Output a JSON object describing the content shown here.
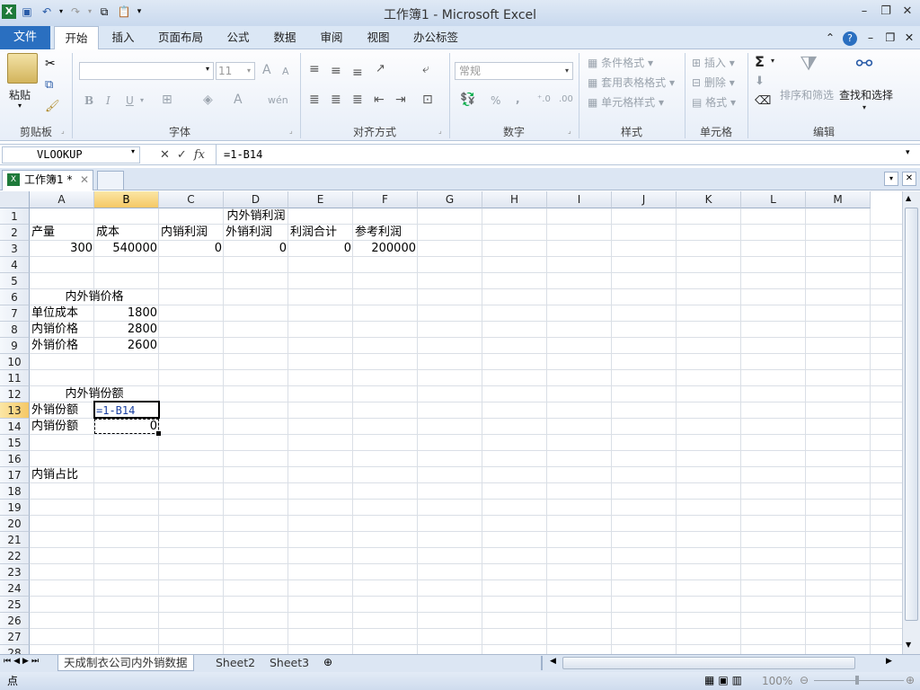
{
  "window": {
    "title": "工作簿1 - Microsoft Excel"
  },
  "qat": {
    "icons": [
      "excel-logo-icon",
      "save-icon",
      "undo-icon",
      "redo-icon",
      "copy-icon",
      "paste-icon",
      "customize-qat-icon"
    ]
  },
  "tabs": [
    "文件",
    "开始",
    "插入",
    "页面布局",
    "公式",
    "数据",
    "审阅",
    "视图",
    "办公标签"
  ],
  "ribbon": {
    "clipboard": {
      "paste": "粘贴",
      "label": "剪贴板"
    },
    "font": {
      "name_value": "",
      "size_value": "11",
      "bold": "B",
      "italic": "I",
      "underline": "U",
      "label": "字体",
      "grow": "A",
      "shrink": "A",
      "fontcolor": "A",
      "phonetic": "wén"
    },
    "alignment": {
      "label": "对齐方式"
    },
    "number": {
      "format_value": "常规",
      "percent": "%",
      "comma": ",",
      "label": "数字"
    },
    "styles": {
      "conditional": "条件格式",
      "table": "套用表格格式",
      "cell_styles": "单元格样式",
      "label": "样式"
    },
    "cells": {
      "insert": "插入",
      "delete": "删除",
      "format": "格式",
      "label": "单元格"
    },
    "editing": {
      "sort": "排序和筛选",
      "find": "查找和选择",
      "label": "编辑",
      "sigma": "Σ"
    }
  },
  "formula_bar": {
    "name_box": "VLOOKUP",
    "fx": "fx",
    "formula": "=1-B14"
  },
  "workbook_tab": {
    "label": "工作簿1 *"
  },
  "columns": [
    "A",
    "B",
    "C",
    "D",
    "E",
    "F",
    "G",
    "H",
    "I",
    "J",
    "K",
    "L",
    "M"
  ],
  "rows": [
    "1",
    "2",
    "3",
    "4",
    "5",
    "6",
    "7",
    "8",
    "9",
    "10",
    "11",
    "12",
    "13",
    "14",
    "15",
    "16",
    "17",
    "18",
    "19",
    "20",
    "21",
    "22",
    "23",
    "24",
    "25",
    "26",
    "27",
    "28"
  ],
  "cells": {
    "c1": "内外销利润",
    "a2": "产量",
    "b2": "成本",
    "c2": "内销利润",
    "d2": "外销利润",
    "e2": "利润合计",
    "f2": "参考利润",
    "a3": "300",
    "b3": "540000",
    "c3": "0",
    "d3": "0",
    "e3": "0",
    "f3": "200000",
    "a6": "内外销价格",
    "a7": "单位成本",
    "b7": "1800",
    "a8": "内销价格",
    "b8": "2800",
    "a9": "外销价格",
    "b9": "2600",
    "a12": "内外销份额",
    "a13": "外销份额",
    "b13": "=1-B14",
    "a14": "内销份额",
    "b14": "0",
    "a17": "内销占比"
  },
  "sheets": [
    "天成制衣公司内外销数据",
    "Sheet2",
    "Sheet3"
  ],
  "status": {
    "mode": "点",
    "zoom": "100%"
  }
}
